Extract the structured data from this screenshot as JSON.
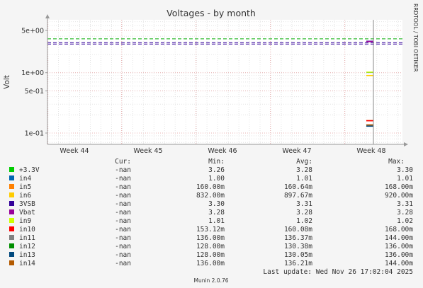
{
  "chart_data": {
    "type": "line",
    "title": "Voltages - by month",
    "ylabel": "Volt",
    "xlabel": "",
    "y_scale": "log",
    "ylim": [
      0.065,
      7.5
    ],
    "y_ticks": [
      {
        "value": 5,
        "label": "5e+00"
      },
      {
        "value": 1,
        "label": "1e+00"
      },
      {
        "value": 0.5,
        "label": "5e-01"
      },
      {
        "value": 0.1,
        "label": "1e-01"
      }
    ],
    "x_ticks": [
      "Week 44",
      "Week 45",
      "Week 46",
      "Week 47",
      "Week 48"
    ],
    "side_label": "RRDTOOL / TOBI OETIKER",
    "grid": true,
    "legend_headers": {
      "cur": "Cur:",
      "min": "Min:",
      "avg": "Avg:",
      "max": "Max:"
    },
    "series": [
      {
        "name": "+3.3V",
        "color": "#00cc00",
        "cur": "-nan",
        "min": "3.26",
        "avg": "3.28",
        "max": "3.30",
        "values": [
          3.28
        ]
      },
      {
        "name": "in4",
        "color": "#0066b3",
        "cur": "-nan",
        "min": "1.00",
        "avg": "1.01",
        "max": "1.01",
        "values": [
          1.01
        ]
      },
      {
        "name": "in5",
        "color": "#ff8000",
        "cur": "-nan",
        "min": "160.00m",
        "avg": "160.64m",
        "max": "168.00m",
        "values": [
          0.16064
        ]
      },
      {
        "name": "in6",
        "color": "#ffcc00",
        "cur": "-nan",
        "min": "832.00m",
        "avg": "897.67m",
        "max": "920.00m",
        "values": [
          0.89767
        ]
      },
      {
        "name": "3VSB",
        "color": "#330099",
        "cur": "-nan",
        "min": "3.30",
        "avg": "3.31",
        "max": "3.31",
        "values": [
          3.31
        ]
      },
      {
        "name": "Vbat",
        "color": "#990099",
        "cur": "-nan",
        "min": "3.28",
        "avg": "3.28",
        "max": "3.28",
        "values": [
          3.28
        ]
      },
      {
        "name": "in9",
        "color": "#ccff00",
        "cur": "-nan",
        "min": "1.01",
        "avg": "1.02",
        "max": "1.02",
        "values": [
          1.02
        ]
      },
      {
        "name": "in10",
        "color": "#ff0000",
        "cur": "-nan",
        "min": "153.12m",
        "avg": "160.08m",
        "max": "168.00m",
        "values": [
          0.16008
        ]
      },
      {
        "name": "in11",
        "color": "#808080",
        "cur": "-nan",
        "min": "136.00m",
        "avg": "136.37m",
        "max": "144.00m",
        "values": [
          0.13637
        ]
      },
      {
        "name": "in12",
        "color": "#008f00",
        "cur": "-nan",
        "min": "128.00m",
        "avg": "130.38m",
        "max": "136.00m",
        "values": [
          0.13038
        ]
      },
      {
        "name": "in13",
        "color": "#00487d",
        "cur": "-nan",
        "min": "128.00m",
        "avg": "130.05m",
        "max": "136.00m",
        "values": [
          0.13005
        ]
      },
      {
        "name": "in14",
        "color": "#b35a00",
        "cur": "-nan",
        "min": "136.00m",
        "avg": "136.21m",
        "max": "144.00m",
        "values": [
          0.13621
        ]
      }
    ],
    "thresholds": [
      {
        "value": 3.63,
        "color": "#00aa00",
        "style": "dashed"
      },
      {
        "value": 3.135,
        "color": "#330099",
        "style": "dashed"
      },
      {
        "value": 2.97,
        "color": "#330099",
        "style": "dashed"
      }
    ],
    "last_update": "Last update: Wed Nov 26 17:02:04 2025",
    "footer": "Munin 2.0.76"
  }
}
